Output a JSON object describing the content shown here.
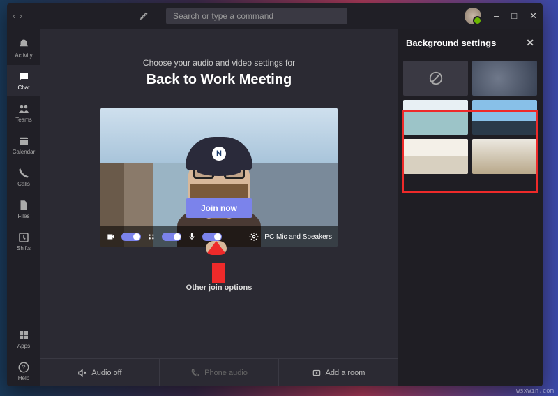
{
  "titlebar": {
    "search_placeholder": "Search or type a command"
  },
  "rail": {
    "items": [
      {
        "label": "Activity"
      },
      {
        "label": "Chat"
      },
      {
        "label": "Teams"
      },
      {
        "label": "Calendar"
      },
      {
        "label": "Calls"
      },
      {
        "label": "Files"
      },
      {
        "label": "Shifts"
      }
    ],
    "apps_label": "Apps",
    "help_label": "Help"
  },
  "prejoin": {
    "instruction": "Choose your audio and video settings for",
    "meeting_title": "Back to Work Meeting",
    "join_label": "Join now",
    "device_label": "PC Mic and Speakers",
    "other_options_label": "Other join options",
    "options": [
      {
        "label": "Audio off"
      },
      {
        "label": "Phone audio"
      },
      {
        "label": "Add a room"
      }
    ]
  },
  "panel": {
    "title": "Background settings"
  },
  "watermark": "wsxwin.com"
}
